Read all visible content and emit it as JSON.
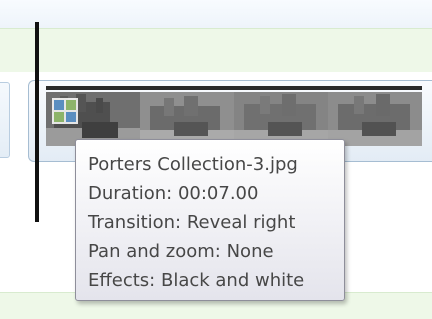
{
  "timeline": {
    "clip": {
      "transition_icon": "transition-icon",
      "thumbnail_style": "black-and-white"
    },
    "tooltip": {
      "lines": [
        "Porters Collection-3.jpg",
        "Duration: 00:07.00",
        "Transition: Reveal right",
        "Pan and zoom: None",
        "Effects: Black and white"
      ]
    }
  }
}
